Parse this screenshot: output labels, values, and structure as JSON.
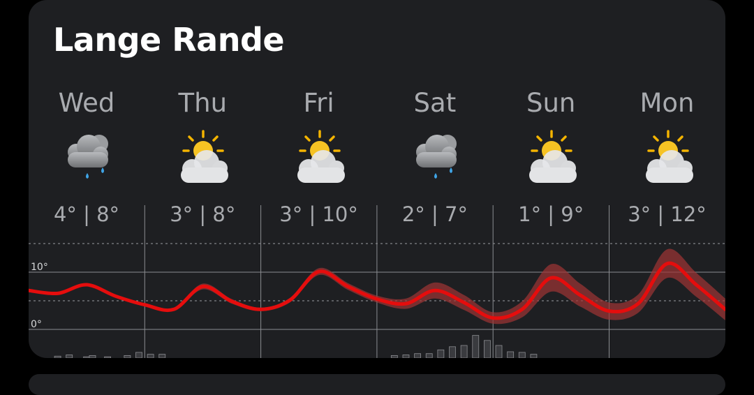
{
  "location": "Lange Rande",
  "days": [
    {
      "name": "Wed",
      "icon": "cloud-rain-icon",
      "low": "4°",
      "high": "8°"
    },
    {
      "name": "Thu",
      "icon": "partly-sunny-icon",
      "low": "3°",
      "high": "8°"
    },
    {
      "name": "Fri",
      "icon": "partly-sunny-icon",
      "low": "3°",
      "high": "10°"
    },
    {
      "name": "Sat",
      "icon": "cloud-rain-icon",
      "low": "2°",
      "high": "7°"
    },
    {
      "name": "Sun",
      "icon": "partly-sunny-icon",
      "low": "1°",
      "high": "9°"
    },
    {
      "name": "Mon",
      "icon": "partly-sunny-icon",
      "low": "3°",
      "high": "12°"
    }
  ],
  "separator": "|",
  "chart_data": {
    "type": "line",
    "ylabels": [
      "10°",
      "0°"
    ],
    "ylim": [
      -1,
      15
    ],
    "x_days": [
      0,
      0.25,
      0.5,
      0.75,
      1.0,
      1.25,
      1.5,
      1.75,
      2.0,
      2.25,
      2.5,
      2.75,
      3.0,
      3.25,
      3.5,
      3.75,
      4.0,
      4.25,
      4.5,
      4.75,
      5.0,
      5.25,
      5.5,
      5.75,
      6.0
    ],
    "series": [
      {
        "values": [
          6.8,
          6.3,
          7.8,
          5.8,
          4.3,
          3.5,
          7.5,
          4.9,
          3.5,
          5.1,
          10.1,
          7.5,
          5.3,
          4.5,
          6.8,
          4.7,
          2.0,
          3.5,
          9.0,
          6.0,
          3.2,
          4.5,
          11.5,
          7.8,
          3.5
        ],
        "spread": [
          0.2,
          0.2,
          0.2,
          0.2,
          0.2,
          0.2,
          0.5,
          0.4,
          0.3,
          0.4,
          0.6,
          0.6,
          0.6,
          0.9,
          1.4,
          1.3,
          1.0,
          1.4,
          2.4,
          2.0,
          1.5,
          1.6,
          2.5,
          2.1,
          1.9
        ]
      }
    ],
    "precip_days": [
      [
        0.25,
        0.15
      ],
      [
        0.35,
        0.25
      ],
      [
        0.5,
        0.1
      ],
      [
        0.55,
        0.2
      ],
      [
        0.68,
        0.1
      ],
      [
        0.85,
        0.2
      ],
      [
        0.95,
        0.45
      ],
      [
        1.05,
        0.3
      ],
      [
        1.15,
        0.3
      ],
      [
        3.15,
        0.2
      ],
      [
        3.25,
        0.25
      ],
      [
        3.35,
        0.35
      ],
      [
        3.45,
        0.35
      ],
      [
        3.55,
        0.65
      ],
      [
        3.65,
        0.9
      ],
      [
        3.75,
        1.0
      ],
      [
        3.85,
        1.8
      ],
      [
        3.95,
        1.4
      ],
      [
        4.05,
        1.0
      ],
      [
        4.15,
        0.5
      ],
      [
        4.25,
        0.45
      ],
      [
        4.35,
        0.3
      ],
      [
        6.0,
        0.2
      ],
      [
        6.15,
        0.1
      ]
    ],
    "line_color": "#e50d0d",
    "band_color": "#a03535"
  }
}
